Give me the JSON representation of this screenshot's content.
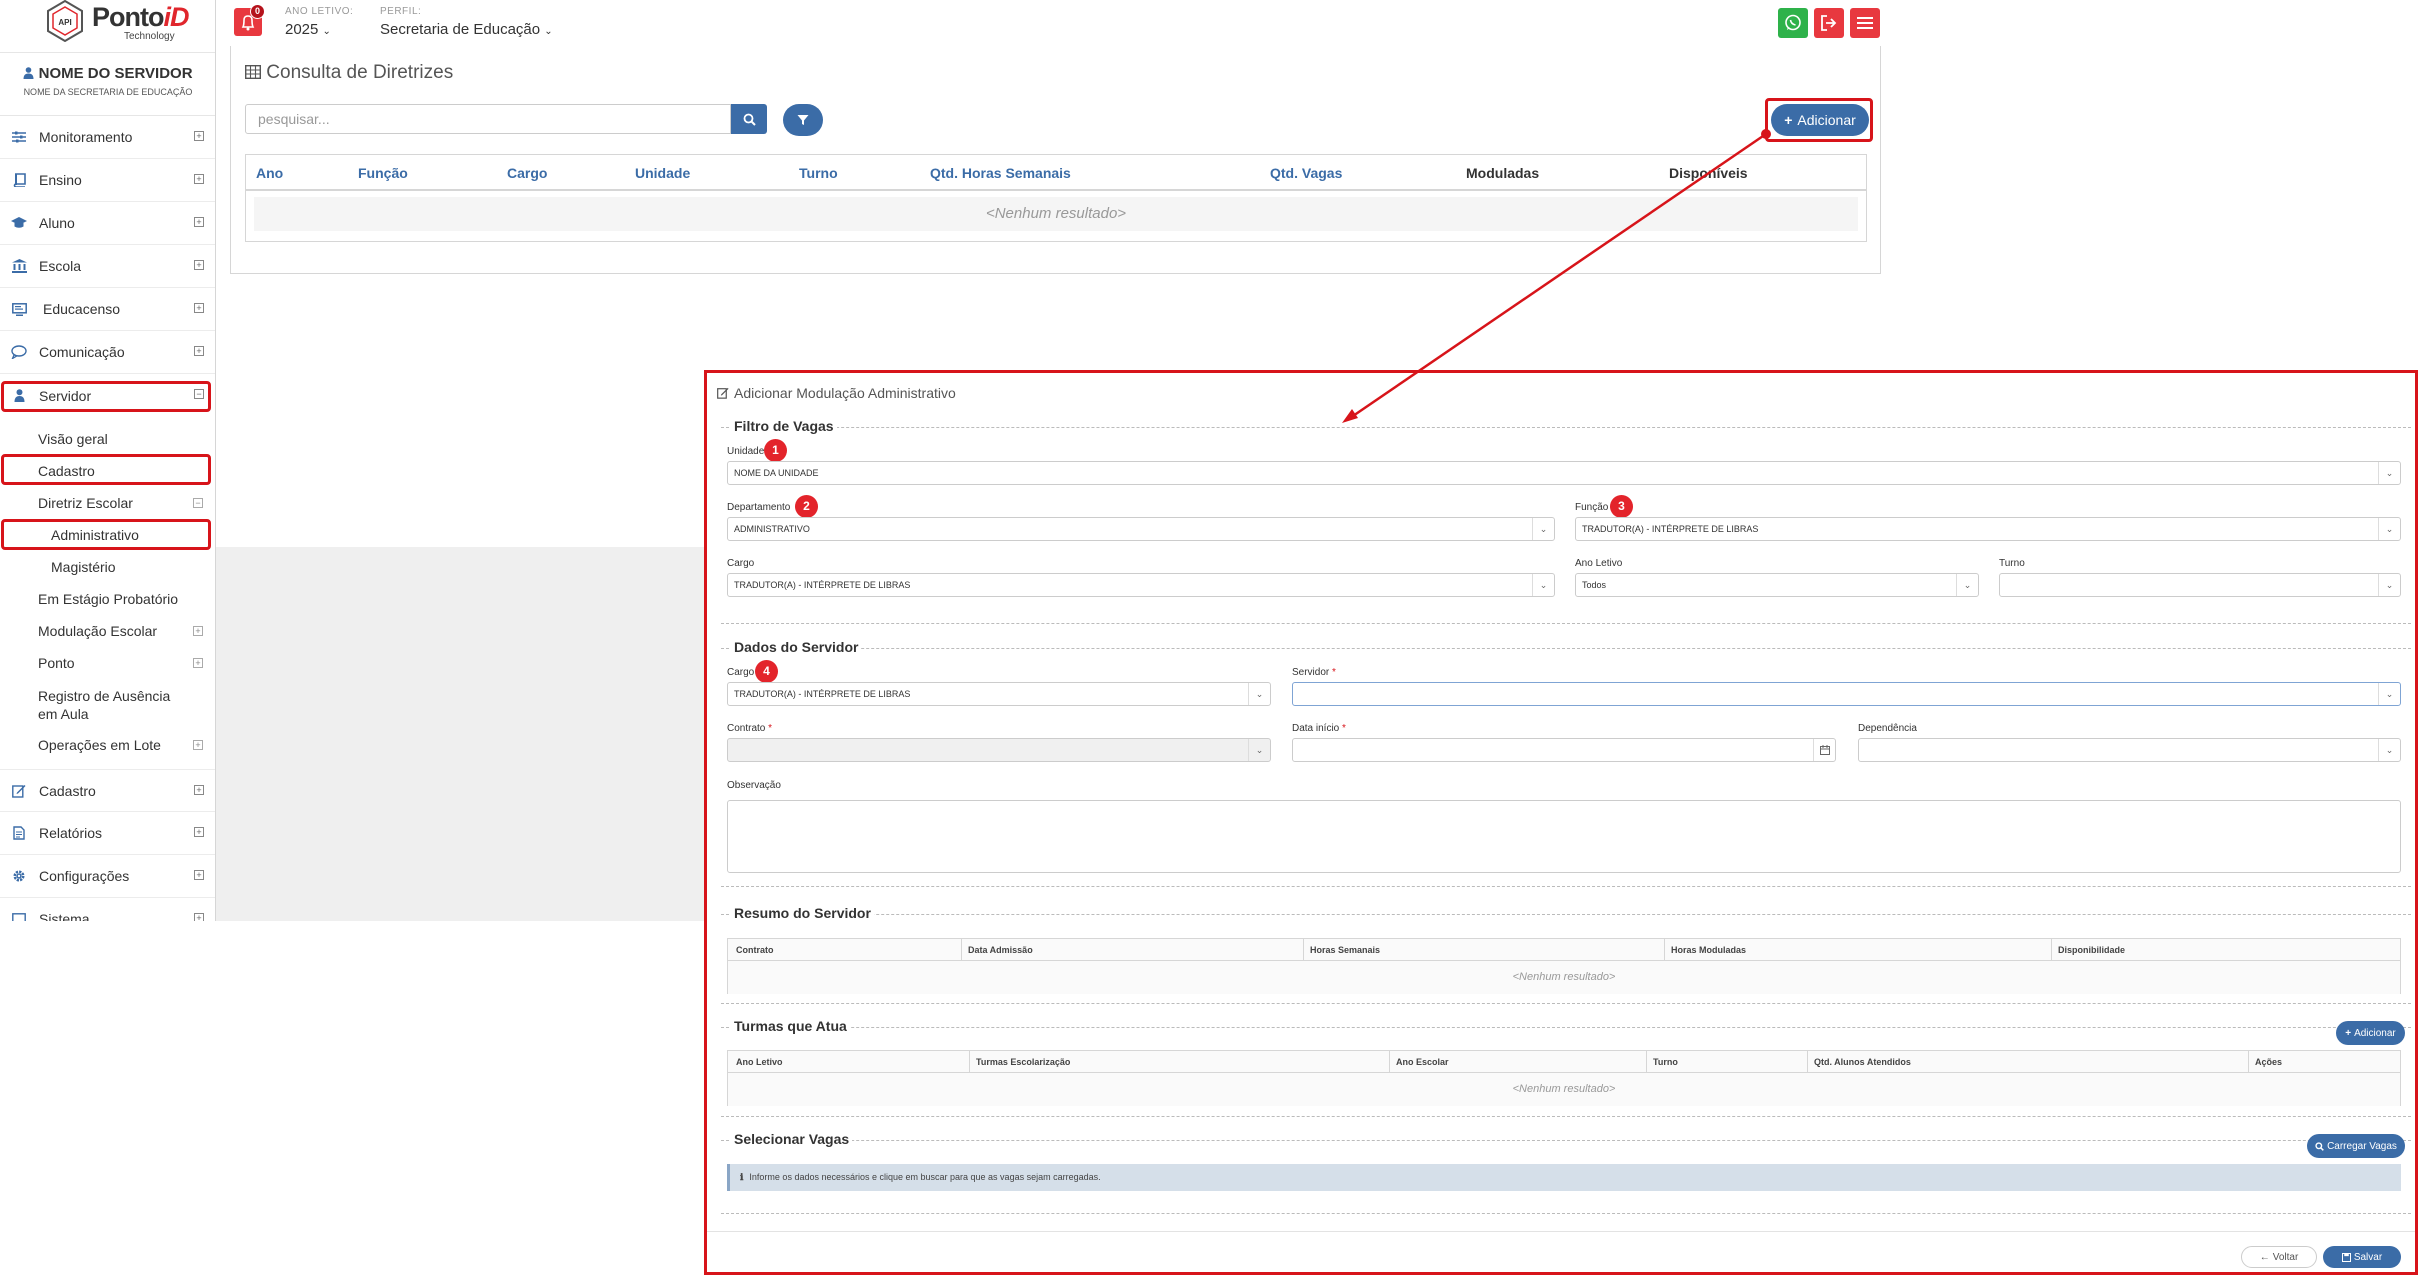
{
  "logo": {
    "brand_main": "Ponto",
    "brand_accent": "iD",
    "tagline": "Technology",
    "mark_text": "API"
  },
  "user": {
    "name": "NOME DO SERVIDOR",
    "subtitle": "NOME DA SECRETARIA DE EDUCAÇÃO"
  },
  "sidebar": {
    "items": [
      {
        "label": "Monitoramento",
        "icon": "sliders-icon"
      },
      {
        "label": "Ensino",
        "icon": "book-icon"
      },
      {
        "label": "Aluno",
        "icon": "graduation-cap-icon"
      },
      {
        "label": "Escola",
        "icon": "building-columns-icon"
      },
      {
        "label": "Educacenso",
        "icon": "monitor-icon"
      },
      {
        "label": "Comunicação",
        "icon": "chat-bubble-icon"
      },
      {
        "label": "Servidor",
        "icon": "user-icon"
      }
    ],
    "servidor_sub": {
      "visao_geral": "Visão geral",
      "cadastro": "Cadastro",
      "diretriz_escolar": "Diretriz Escolar",
      "administrativo": "Administrativo",
      "magisterio": "Magistério",
      "estagio": "Em Estágio Probatório",
      "modulacao": "Modulação Escolar",
      "ponto": "Ponto",
      "registro_ausencia": "Registro de Ausência em Aula",
      "operacoes_lote": "Operações em Lote"
    },
    "bottom_items": [
      {
        "label": "Cadastro",
        "icon": "edit-icon"
      },
      {
        "label": "Relatórios",
        "icon": "document-icon"
      },
      {
        "label": "Configurações",
        "icon": "gear-icon"
      },
      {
        "label": "Sistema",
        "icon": "system-icon"
      }
    ],
    "toggle_expand": "+",
    "toggle_collapse": "−"
  },
  "topbar": {
    "notifications_count": "0",
    "ano_letivo_label": "ANO LETIVO:",
    "ano_letivo_value": "2025",
    "perfil_label": "PERFIL:",
    "perfil_value": "Secretaria de Educação",
    "colors": {
      "whatsapp": "#2eb24a",
      "logout": "#e8383f",
      "menu": "#e8383f"
    }
  },
  "consulta": {
    "title": "Consulta de Diretrizes",
    "search_placeholder": "pesquisar...",
    "add_label": "Adicionar",
    "columns": [
      "Ano",
      "Função",
      "Cargo",
      "Unidade",
      "Turno",
      "Qtd. Horas Semanais",
      "Qtd. Vagas",
      "Moduladas",
      "Disponíveis"
    ],
    "empty": "<Nenhum resultado>"
  },
  "modal": {
    "title": "Adicionar Modulação Administrativo",
    "filtro": {
      "title": "Filtro de Vagas",
      "unidade_label": "Unidade",
      "unidade_value": "NOME DA UNIDADE",
      "departamento_label": "Departamento",
      "departamento_value": "ADMINISTRATIVO",
      "funcao_label": "Função",
      "funcao_value": "TRADUTOR(A) - INTÉRPRETE DE LIBRAS",
      "cargo_label": "Cargo",
      "cargo_value": "TRADUTOR(A) - INTÉRPRETE DE LIBRAS",
      "ano_letivo_label": "Ano Letivo",
      "ano_letivo_value": "Todos",
      "turno_label": "Turno",
      "turno_value": ""
    },
    "dados": {
      "title": "Dados do Servidor",
      "cargo_label": "Cargo",
      "cargo_value": "TRADUTOR(A) - INTÉRPRETE DE LIBRAS",
      "servidor_label": "Servidor",
      "contrato_label": "Contrato",
      "data_inicio_label": "Data início",
      "dependencia_label": "Dependência",
      "observacao_label": "Observação",
      "required_mark": "*"
    },
    "resumo": {
      "title": "Resumo do Servidor",
      "columns": [
        "Contrato",
        "Data Admissão",
        "Horas Semanais",
        "Horas Moduladas",
        "Disponibilidade"
      ],
      "empty": "<Nenhum resultado>"
    },
    "turmas": {
      "title": "Turmas que Atua",
      "add_label": "Adicionar",
      "columns": [
        "Ano Letivo",
        "Turmas Escolarização",
        "Ano Escolar",
        "Turno",
        "Qtd. Alunos Atendidos",
        "Ações"
      ],
      "empty": "<Nenhum resultado>"
    },
    "vagas": {
      "title": "Selecionar Vagas",
      "load_label": "Carregar Vagas",
      "info": "Informe os dados necessários e clique em buscar para que as vagas sejam carregadas."
    },
    "voltar_label": "Voltar",
    "salvar_label": "Salvar",
    "badges": [
      "1",
      "2",
      "3",
      "4"
    ]
  }
}
